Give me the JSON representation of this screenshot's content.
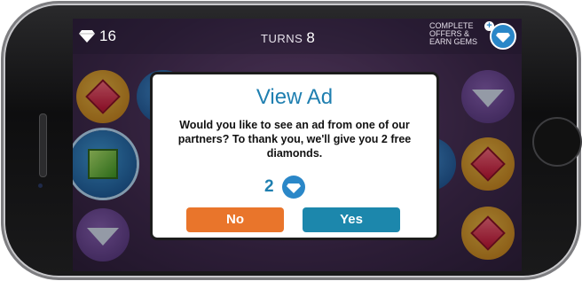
{
  "hud": {
    "gem_count": "16",
    "turns_label": "TURNS",
    "turns_value": "8",
    "offers_text": [
      "COMPLETE",
      "OFFERS &",
      "EARN GEMS"
    ],
    "plus_symbol": "+"
  },
  "modal": {
    "title": "View Ad",
    "body": "Would you like to see an ad from one of our partners? To thank you, we'll give you 2 free diamonds.",
    "reward_amount": "2",
    "no_label": "No",
    "yes_label": "Yes"
  },
  "colors": {
    "accent_blue": "#1f7fb0",
    "no_button": "#e9752b",
    "yes_button": "#1c87ac"
  },
  "icons": {
    "gem": "diamond-icon",
    "offers": "diamond-badge-icon"
  }
}
